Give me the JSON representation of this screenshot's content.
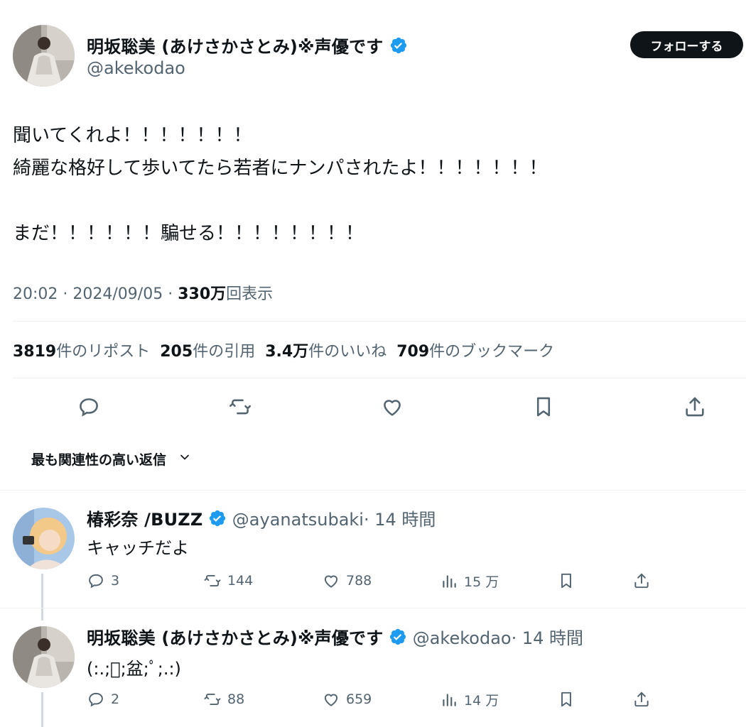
{
  "tweet": {
    "display_name": "明坂聡美 (あけさかさとみ)※声優です",
    "handle": "@akekodao",
    "follow_label": "フォローする",
    "lines": [
      "聞いてくれよ！！！！！！！",
      "綺麗な格好して歩いてたら若者にナンパされたよ！！！！！！！",
      "",
      "まだ！！！！！！騙せる！！！！！！！！"
    ],
    "time": "20:02",
    "date": "2024/09/05",
    "views_num": "330万",
    "views_label": "回表示",
    "sep": "·"
  },
  "stats": {
    "reposts_num": "3819",
    "reposts_label": "件のリポスト",
    "quotes_num": "205",
    "quotes_label": "件の引用",
    "likes_num": "3.4万",
    "likes_label": "件のいいね",
    "bookmarks_num": "709",
    "bookmarks_label": "件のブックマーク"
  },
  "actions": [
    "reply-icon",
    "repost-icon",
    "like-icon",
    "bookmark-icon",
    "share-icon"
  ],
  "sort": {
    "label": "最も関連性の高い返信"
  },
  "replies": [
    {
      "display_name": "椿彩奈 /BUZZ",
      "handle": "@ayanatsubaki",
      "time": "· 14 時間",
      "text": "キャッチだよ",
      "replies": "3",
      "reposts": "144",
      "likes": "788",
      "views": "15 万"
    },
    {
      "display_name": "明坂聡美 (あけさかさとみ)※声優です",
      "handle": "@akekodao",
      "time": "· 14 時間",
      "text": "(:.;ﾟ;盆;ﾟ;.:)",
      "replies": "2",
      "reposts": "88",
      "likes": "659",
      "views": "14 万"
    }
  ],
  "colors": {
    "text": "#0f1419",
    "muted": "#536471",
    "verified": "#1d9bf0",
    "divider": "#eff3f4",
    "button_bg": "#0f1419"
  }
}
